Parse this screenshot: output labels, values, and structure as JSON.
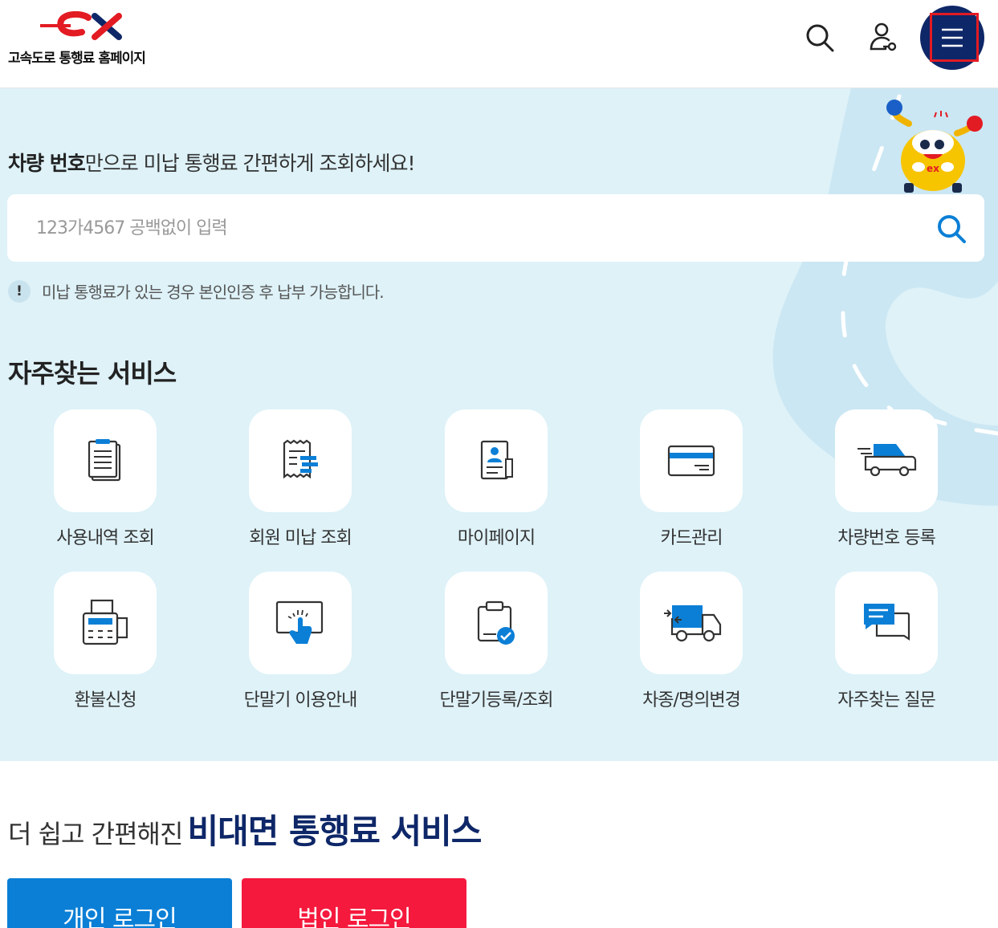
{
  "header": {
    "logo_text": "고속도로 통행료 홈페이지",
    "logo_mark": "ex",
    "search_icon": "search-icon",
    "user_icon": "user-key-icon",
    "menu_icon": "hamburger-menu-icon",
    "menu_color": "#0e2768"
  },
  "hero": {
    "title_bold": "차량 번호",
    "title_rest": "만으로 미납 통행료 간편하게 조회하세요!",
    "search_placeholder": "123가4567 공백없이 입력",
    "search_value": "",
    "notice_icon": "!",
    "notice": "미납 통행료가 있는 경우 본인인증 후 납부 가능합니다.",
    "background_color": "#def2f8"
  },
  "services": {
    "title": "자주찾는 서비스",
    "items": [
      {
        "label": "사용내역 조회",
        "icon": "document-list-icon"
      },
      {
        "label": "회원 미납 조회",
        "icon": "receipt-icon"
      },
      {
        "label": "마이페이지",
        "icon": "profile-document-icon"
      },
      {
        "label": "카드관리",
        "icon": "credit-card-icon"
      },
      {
        "label": "차량번호 등록",
        "icon": "car-icon"
      },
      {
        "label": "환불신청",
        "icon": "fax-machine-icon"
      },
      {
        "label": "단말기 이용안내",
        "icon": "touch-screen-icon"
      },
      {
        "label": "단말기등록/조회",
        "icon": "clipboard-check-icon"
      },
      {
        "label": "차종/명의변경",
        "icon": "truck-exchange-icon"
      },
      {
        "label": "자주찾는 질문",
        "icon": "chat-bubbles-icon"
      }
    ]
  },
  "promo": {
    "text_normal": "더 쉽고 간편해진",
    "text_strong": "비대면 통행료 서비스"
  },
  "buttons": {
    "personal_login": "개인 로그인",
    "corporate_login": "법인 로그인",
    "personal_color": "#0b7fd6",
    "corporate_color": "#f5193d"
  }
}
